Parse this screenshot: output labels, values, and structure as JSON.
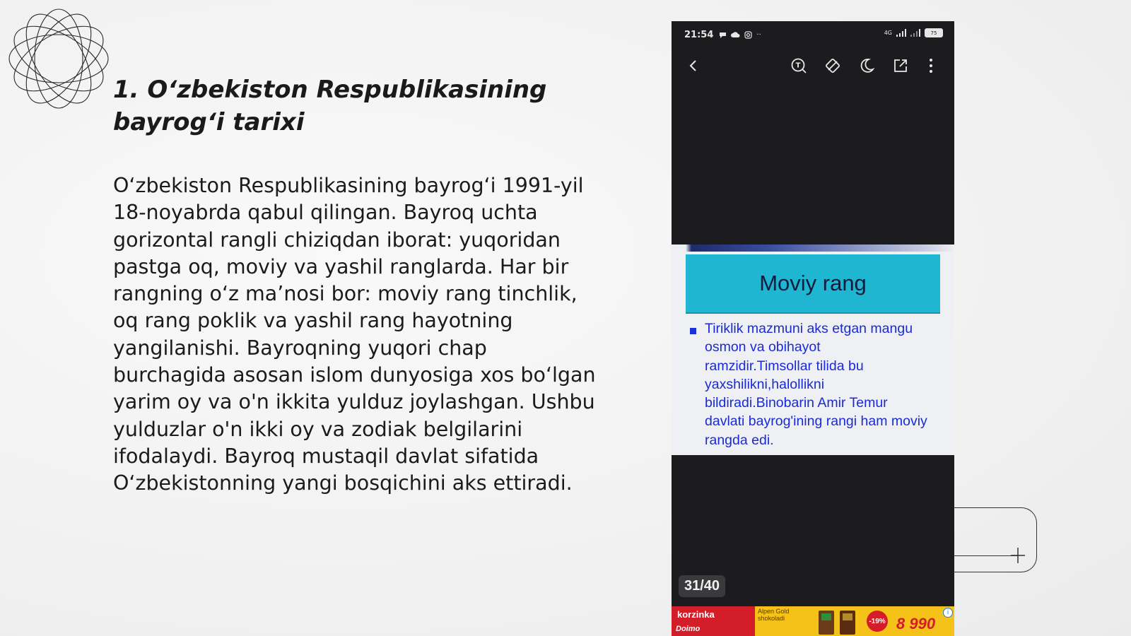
{
  "slide": {
    "title_line1": "1. O‘zbekiston Respublikasining",
    "title_line2": "bayrog‘i tarixi",
    "body": "O‘zbekiston Respublikasining bayrog‘i 1991-yil 18-noyabrda qabul qilingan. Bayroq uchta gorizontal rangli chiziqdan iborat: yuqoridan pastga oq, moviy va yashil ranglarda. Har bir rangning o‘z ma’nosi bor: moviy rang tinchlik, oq rang poklik va yashil rang hayotning yangilanishi. Bayroqning yuqori chap burchagida asosan islom dunyosiga xos bo‘lgan yarim oy va o'n ikkita yulduz joylashgan. Ushbu yulduzlar o'n ikki oy va zodiak belgilarini ifodalaydi. Bayroq mustaqil davlat sifatida O‘zbekistonning yangi bosqichini aks ettiradi."
  },
  "phone": {
    "status": {
      "time": "21:54",
      "network": "4G",
      "battery": "75"
    },
    "toolbar": {
      "icons": [
        "back-icon",
        "text-search-icon",
        "rotate-icon",
        "night-mode-icon",
        "share-icon",
        "more-icon"
      ]
    },
    "document": {
      "header": "Moviy rang",
      "bullet_text": "Tiriklik mazmuni aks etgan mangu osmon va obihayot ramzidir.Timsollar tilida bu yaxshilikni,halollikni bildiradi.Binobarin Amir Temur davlati bayrog'ining rangi ham moviy rangda edi.",
      "header_color": "#1fb6d2",
      "text_color": "#1a2ad6"
    },
    "page_counter": "31/40",
    "ad": {
      "brand": "korzinka",
      "sub": "Doimo",
      "desc": "Alpen Gold shokoladi",
      "discount": "-19%",
      "price": "8 990"
    }
  }
}
